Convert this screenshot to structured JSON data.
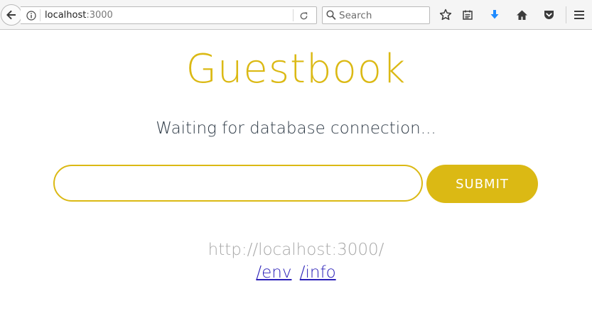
{
  "browser": {
    "url_host": "localhost",
    "url_port": ":3000",
    "search_placeholder": "Search",
    "icons": {
      "back": "back-arrow-icon",
      "info": "info-icon",
      "reload": "reload-icon",
      "search": "search-icon",
      "bookmark": "star-icon",
      "library": "bookmarks-list-icon",
      "downloads": "download-arrow-icon",
      "home": "home-icon",
      "pocket": "pocket-icon",
      "menu": "hamburger-menu-icon"
    },
    "download_color": "#1f8bff"
  },
  "page": {
    "title": "Guestbook",
    "status": "Waiting for database connection...",
    "form": {
      "input_value": "",
      "input_placeholder": "",
      "submit_label": "SUBMIT"
    },
    "host_url": "http://localhost:3000/",
    "links": [
      {
        "label": "/env"
      },
      {
        "label": "/info"
      }
    ]
  },
  "colors": {
    "accent": "#dbb914",
    "status_text": "#2f3b47",
    "muted_text": "#a8a8a8",
    "link": "#2a1fb8"
  }
}
